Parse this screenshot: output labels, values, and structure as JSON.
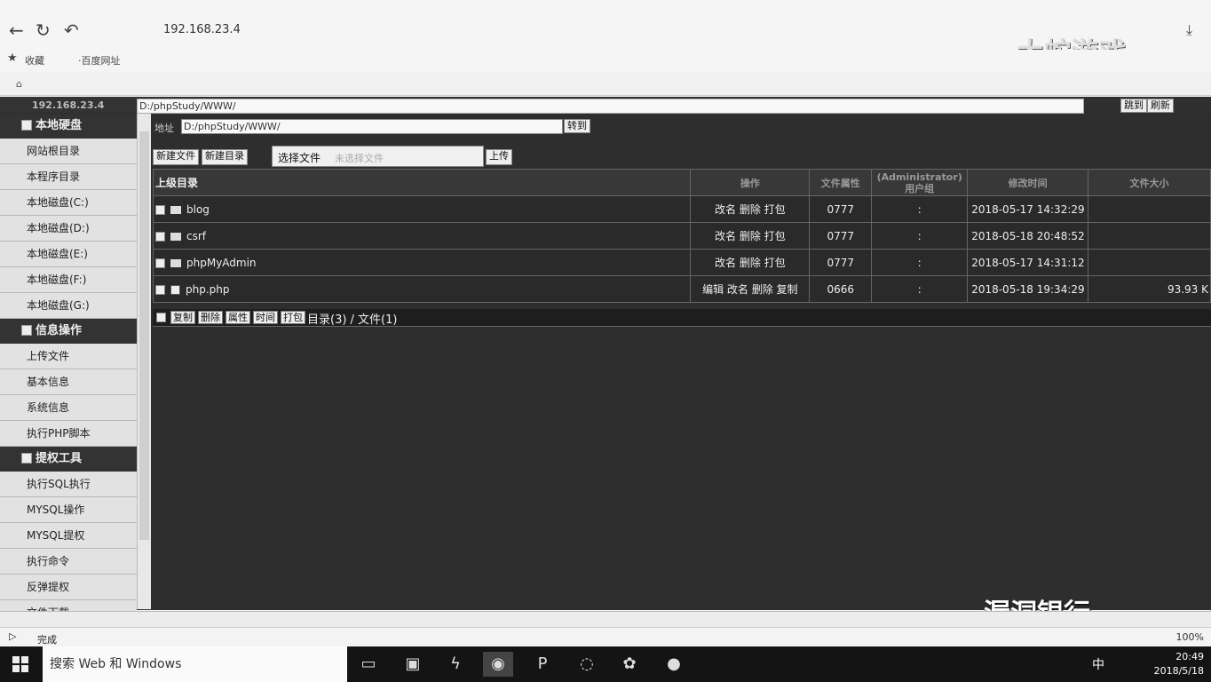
{
  "browser": {
    "url": "192.168.23.4",
    "bookmarks_label": "收藏",
    "bookmark2": "·百度网址",
    "status": "完成",
    "zoom": "100%",
    "logo_text": "大蛇游戏"
  },
  "shell": {
    "ip": "192.168.23.4",
    "path": "D:/phpStudy/WWW/",
    "jump_label": "跳到",
    "refresh_label": "刷新"
  },
  "sidebar": {
    "sections": [
      {
        "title": "本地硬盘",
        "items": [
          "网站根目录",
          "本程序目录",
          "本地磁盘(C:)",
          "本地磁盘(D:)",
          "本地磁盘(E:)",
          "本地磁盘(F:)",
          "本地磁盘(G:)"
        ]
      },
      {
        "title": "信息操作",
        "items": [
          "上传文件",
          "基本信息",
          "系统信息",
          "执行PHP脚本"
        ]
      },
      {
        "title": "提权工具",
        "items": [
          "执行SQL执行",
          "MYSQL操作",
          "MYSQL提权",
          "执行命令",
          "反弹提权",
          "文件下载"
        ]
      }
    ]
  },
  "main": {
    "address_label": "地址",
    "address_value": "D:/phpStudy/WWW/",
    "go_label": "转到",
    "new_file": "新建文件",
    "new_dir": "新建目录",
    "choose_file": "选择文件",
    "choose_placeholder": "未选择文件",
    "upload": "上传",
    "headers": [
      "上级目录",
      "操作",
      "文件属性",
      "(Administrator)\n用户组",
      "修改时间",
      "文件大小"
    ],
    "rows": [
      {
        "name": "blog",
        "type": "folder",
        "ops": "改名 删除 打包",
        "perm": "0777",
        "group": ":",
        "time": "2018-05-17 14:32:29",
        "size": ""
      },
      {
        "name": "csrf",
        "type": "folder",
        "ops": "改名 删除 打包",
        "perm": "0777",
        "group": ":",
        "time": "2018-05-18 20:48:52",
        "size": ""
      },
      {
        "name": "phpMyAdmin",
        "type": "folder",
        "ops": "改名 删除 打包",
        "perm": "0777",
        "group": ":",
        "time": "2018-05-17 14:31:12",
        "size": ""
      },
      {
        "name": "php.php",
        "type": "file",
        "ops": "编辑 改名 删除 复制",
        "perm": "0666",
        "group": ":",
        "time": "2018-05-18 19:34:29",
        "size": "93.93 K"
      }
    ],
    "footer_buttons": [
      "复制",
      "删除",
      "属性",
      "时间",
      "打包"
    ],
    "summary": "目录(3) / 文件(1)"
  },
  "watermark": "漏洞银行",
  "taskbar": {
    "search": "搜索 Web 和 Windows",
    "time": "20:49",
    "date": "2018/5/18",
    "ime": "中"
  }
}
